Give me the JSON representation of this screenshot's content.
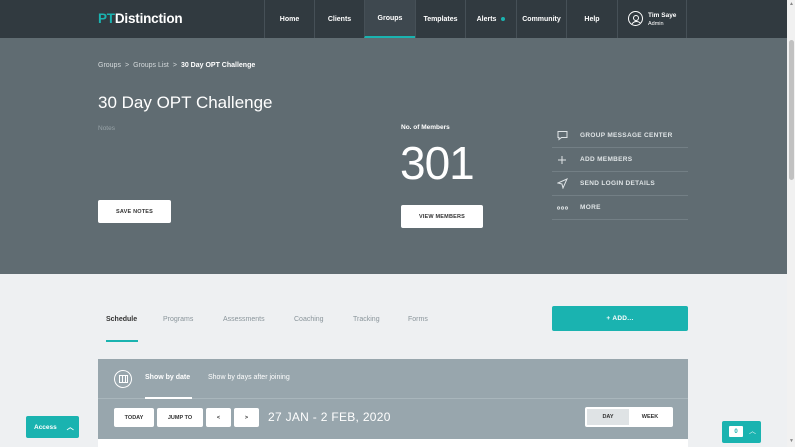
{
  "nav": {
    "logo_pt": "PT",
    "logo_rest": "Distinction",
    "items": [
      {
        "label": "Home"
      },
      {
        "label": "Clients"
      },
      {
        "label": "Groups"
      },
      {
        "label": "Templates"
      },
      {
        "label": "Alerts"
      },
      {
        "label": "Community"
      },
      {
        "label": "Help"
      }
    ],
    "active": "Groups",
    "user": {
      "name": "Tim Saye",
      "role": "Admin",
      "icon": "user-avatar-icon"
    }
  },
  "breadcrumb": {
    "items": [
      "Groups",
      "Groups List",
      "30 Day OPT Challenge"
    ],
    "separator": ">"
  },
  "group": {
    "title": "30 Day OPT Challenge",
    "notes_label": "Notes",
    "save_notes": "SAVE NOTES",
    "members_label": "No. of Members",
    "members_count": "301",
    "view_members": "VIEW MEMBERS"
  },
  "actions": [
    {
      "label": "GROUP MESSAGE CENTER",
      "icon": "message-icon"
    },
    {
      "label": "ADD MEMBERS",
      "icon": "plus-icon"
    },
    {
      "label": "SEND LOGIN DETAILS",
      "icon": "send-icon"
    },
    {
      "label": "MORE",
      "icon": "more-dots-icon"
    }
  ],
  "tabs": [
    "Schedule",
    "Programs",
    "Assessments",
    "Coaching",
    "Tracking",
    "Forms"
  ],
  "active_tab": "Schedule",
  "add_button": "+ ADD...",
  "schedule": {
    "show_by_date": "Show by date",
    "show_by_days": "Show by days after joining",
    "today": "TODAY",
    "jump_to": "JUMP TO",
    "prev": "<",
    "next": ">",
    "date_range": "27 JAN - 2 FEB, 2020",
    "view_day": "DAY",
    "view_week": "WEEK",
    "active_view": "WEEK"
  },
  "footer": {
    "access": "Access",
    "chat_count": "0"
  },
  "colors": {
    "accent": "#1ab3b0",
    "nav_bg": "#313a40",
    "hero_bg": "#606c72"
  }
}
